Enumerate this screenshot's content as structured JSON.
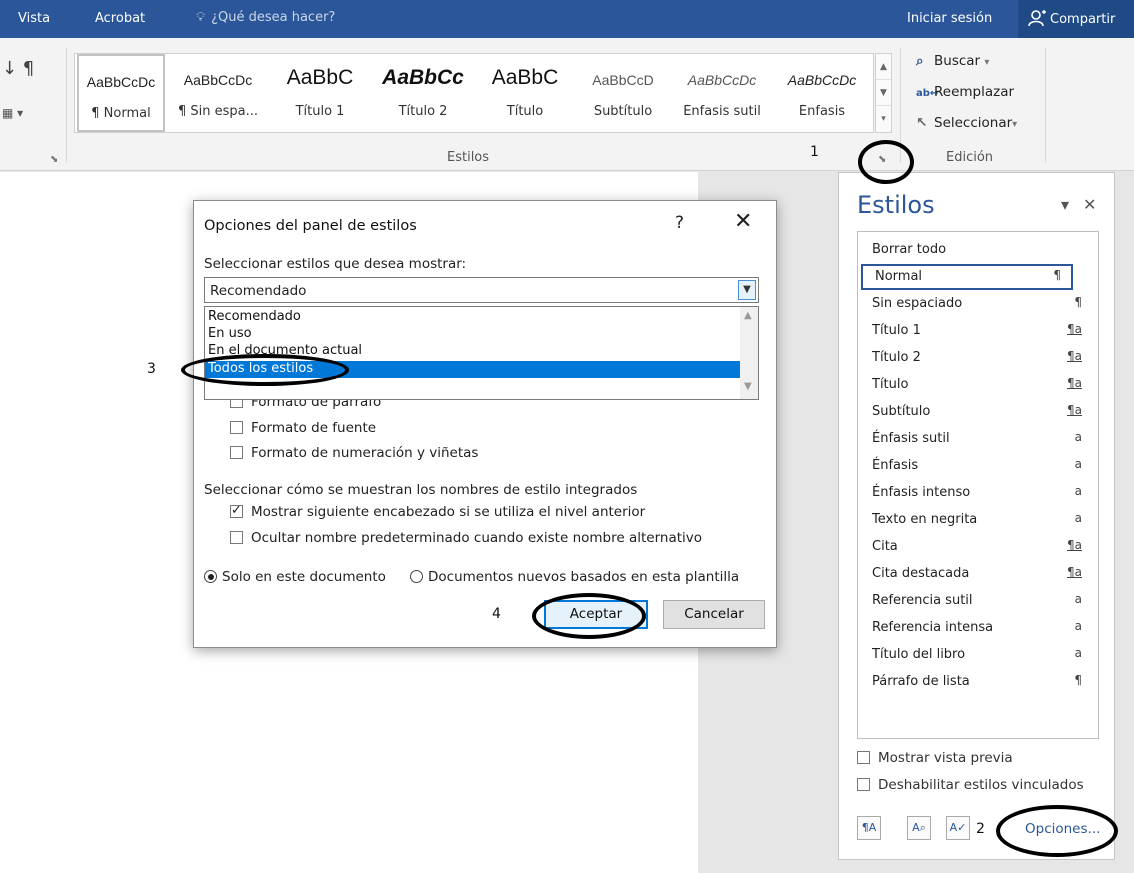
{
  "menubar": {
    "tab_vista": "Vista",
    "tab_acrobat": "Acrobat",
    "tell_me": "¿Qué desea hacer?",
    "sign_in": "Iniciar sesión",
    "share": "Compartir"
  },
  "ribbon": {
    "style_gallery": [
      {
        "sample": "AaBbCcDc",
        "name": "¶ Normal"
      },
      {
        "sample": "AaBbCcDc",
        "name": "¶ Sin espa..."
      },
      {
        "sample": "AaBbC",
        "name": "Título 1"
      },
      {
        "sample": "AaBbCc",
        "name": "Título 2"
      },
      {
        "sample": "AaBbC",
        "name": "Título"
      },
      {
        "sample": "AaBbCcD",
        "name": "Subtítulo"
      },
      {
        "sample": "AaBbCcDc",
        "name": "Énfasis sutil"
      },
      {
        "sample": "AaBbCcDc",
        "name": "Énfasis"
      }
    ],
    "styles_group_label": "Estilos",
    "editing": {
      "find": "Buscar",
      "replace": "Reemplazar",
      "select": "Seleccionar",
      "group_label": "Edición"
    }
  },
  "annotations": {
    "step1": "1",
    "step2": "2",
    "step3": "3",
    "step4": "4"
  },
  "styles_pane": {
    "title": "Estilos",
    "items": [
      {
        "name": "Borrar todo",
        "mark": ""
      },
      {
        "name": "Normal",
        "mark": "¶"
      },
      {
        "name": "Sin espaciado",
        "mark": "¶"
      },
      {
        "name": "Título 1",
        "mark": "¶a"
      },
      {
        "name": "Título 2",
        "mark": "¶a"
      },
      {
        "name": "Título",
        "mark": "¶a"
      },
      {
        "name": "Subtítulo",
        "mark": "¶a"
      },
      {
        "name": "Énfasis sutil",
        "mark": "a"
      },
      {
        "name": "Énfasis",
        "mark": "a"
      },
      {
        "name": "Énfasis intenso",
        "mark": "a"
      },
      {
        "name": "Texto en negrita",
        "mark": "a"
      },
      {
        "name": "Cita",
        "mark": "¶a"
      },
      {
        "name": "Cita destacada",
        "mark": "¶a"
      },
      {
        "name": "Referencia sutil",
        "mark": "a"
      },
      {
        "name": "Referencia intensa",
        "mark": "a"
      },
      {
        "name": "Título del libro",
        "mark": "a"
      },
      {
        "name": "Párrafo de lista",
        "mark": "¶"
      }
    ],
    "show_preview": "Mostrar vista previa",
    "disable_linked": "Deshabilitar estilos vinculados",
    "options_link": "Opciones..."
  },
  "dialog": {
    "title": "Opciones del panel de estilos",
    "help": "?",
    "select_label": "Seleccionar estilos que desea mostrar:",
    "combo_value": "Recomendado",
    "dropdown_options": [
      "Recomendado",
      "En uso",
      "En el documento actual",
      "Todos los estilos"
    ],
    "format_checks": [
      "Formato de párrafo",
      "Formato de fuente",
      "Formato de numeración y viñetas"
    ],
    "builtin_label": "Seleccionar cómo se muestran los nombres de estilo integrados",
    "show_next_heading": "Mostrar siguiente encabezado si se utiliza el nivel anterior",
    "hide_default_name": "Ocultar nombre predeterminado cuando existe nombre alternativo",
    "radio_this_doc": "Solo en este documento",
    "radio_new_docs": "Documentos nuevos basados en esta plantilla",
    "ok": "Aceptar",
    "cancel": "Cancelar"
  },
  "colors": {
    "title_bar": "#2b579a",
    "accent": "#0078d7"
  }
}
